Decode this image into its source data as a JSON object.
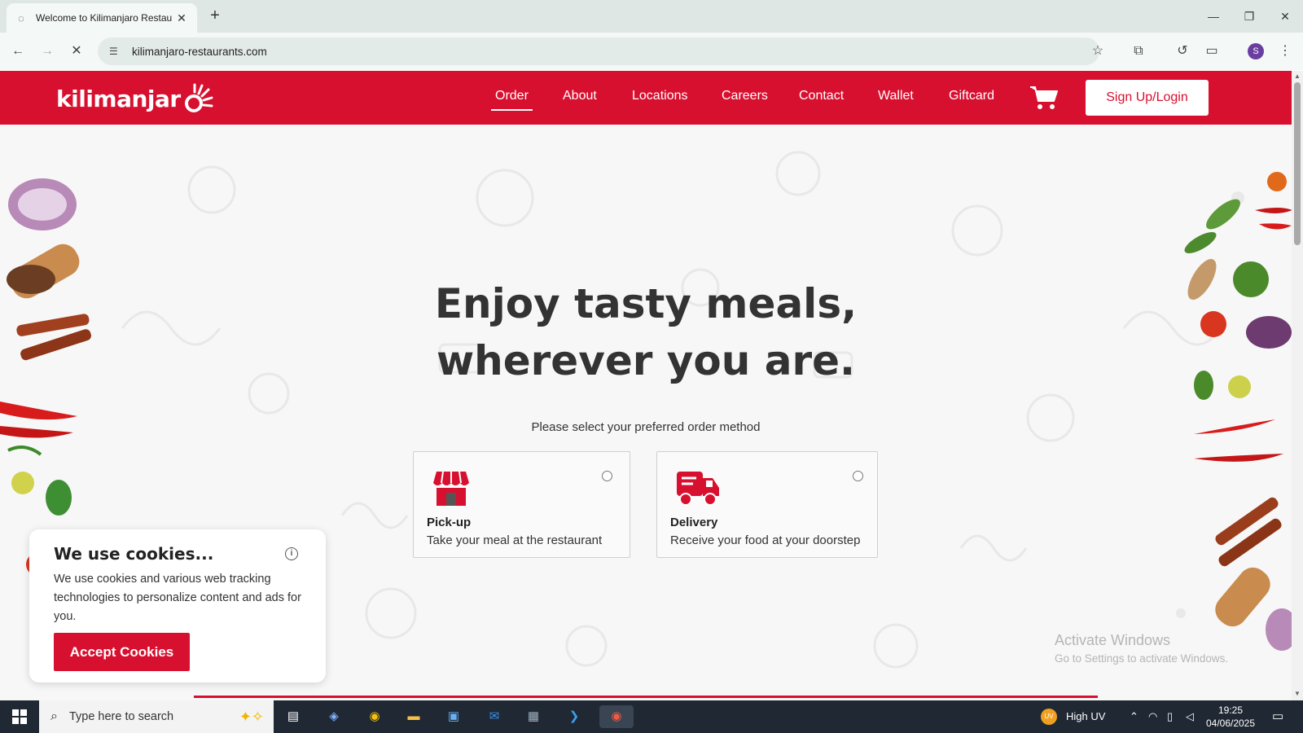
{
  "browser": {
    "tab_title": "Welcome to Kilimanjaro Restau",
    "url": "kilimanjaro-restaurants.com"
  },
  "site": {
    "logo_text": "kilimanjar",
    "brand_color": "#d8102f",
    "nav": [
      {
        "label": "Order",
        "active": true
      },
      {
        "label": "About"
      },
      {
        "label": "Locations"
      },
      {
        "label": "Careers"
      },
      {
        "label": "Contact"
      },
      {
        "label": "Wallet"
      },
      {
        "label": "Giftcard"
      }
    ],
    "signup_label": "Sign Up/Login"
  },
  "hero": {
    "line1": "Enjoy tasty meals,",
    "line2": "wherever you are."
  },
  "order": {
    "prompt": "Please select your preferred order method",
    "options": [
      {
        "title": "Pick-up",
        "desc": "Take your meal at the restaurant",
        "icon": "store-icon"
      },
      {
        "title": "Delivery",
        "desc": "Receive your food at your doorstep",
        "icon": "delivery-truck-icon"
      }
    ]
  },
  "cookies": {
    "title": "We use cookies...",
    "body": "We use cookies and various web tracking technologies to personalize content and ads for you.",
    "accept_label": "Accept Cookies"
  },
  "watermark": {
    "line1": "Activate Windows",
    "line2": "Go to Settings to activate Windows."
  },
  "taskbar": {
    "search_placeholder": "Type here to search",
    "weather_badge": "UV",
    "weather": "High UV",
    "time": "19:25",
    "date": "04/06/2025"
  }
}
